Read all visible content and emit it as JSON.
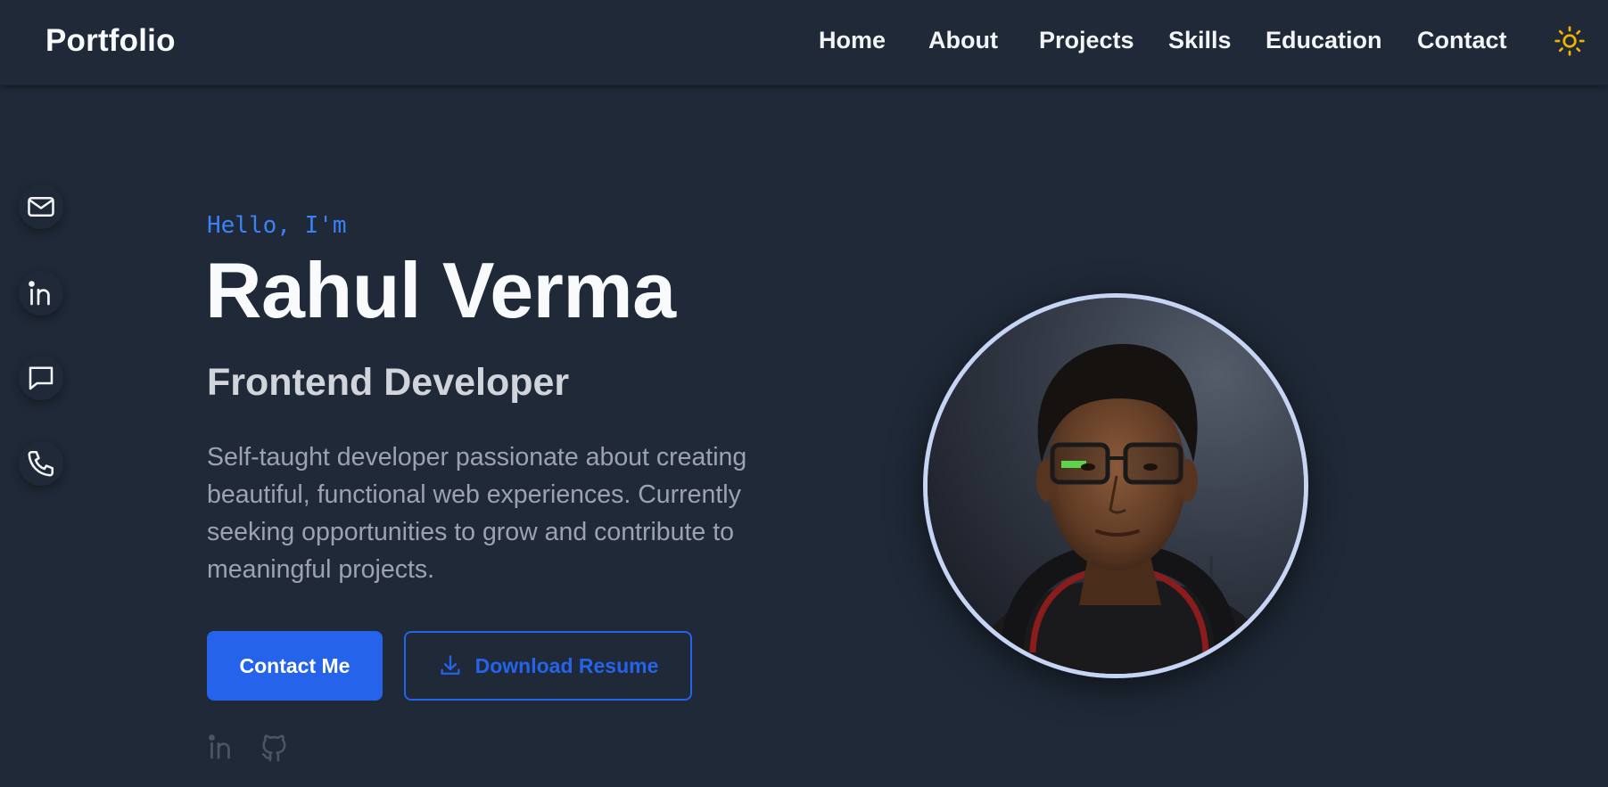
{
  "nav": {
    "brand": "Portfolio",
    "links": [
      "Home",
      "About",
      "Projects",
      "Skills",
      "Education",
      "Contact"
    ],
    "theme_icon": "sun-icon"
  },
  "side_social": [
    "mail-icon",
    "linkedin-icon",
    "message-icon",
    "phone-icon"
  ],
  "hero": {
    "greeting": "Hello, I'm",
    "name": "Rahul Verma",
    "role": "Frontend Developer",
    "bio": "Self-taught developer passionate about creating beautiful, functional web experiences. Currently seeking opportunities to grow and contribute to meaningful projects.",
    "primary_button": "Contact Me",
    "secondary_button": "Download Resume",
    "mini_social": [
      "linkedin-icon",
      "github-icon"
    ]
  },
  "colors": {
    "background": "#1f2937",
    "accent": "#2563eb",
    "greeting": "#3b82f6",
    "sun": "#f5b301"
  }
}
